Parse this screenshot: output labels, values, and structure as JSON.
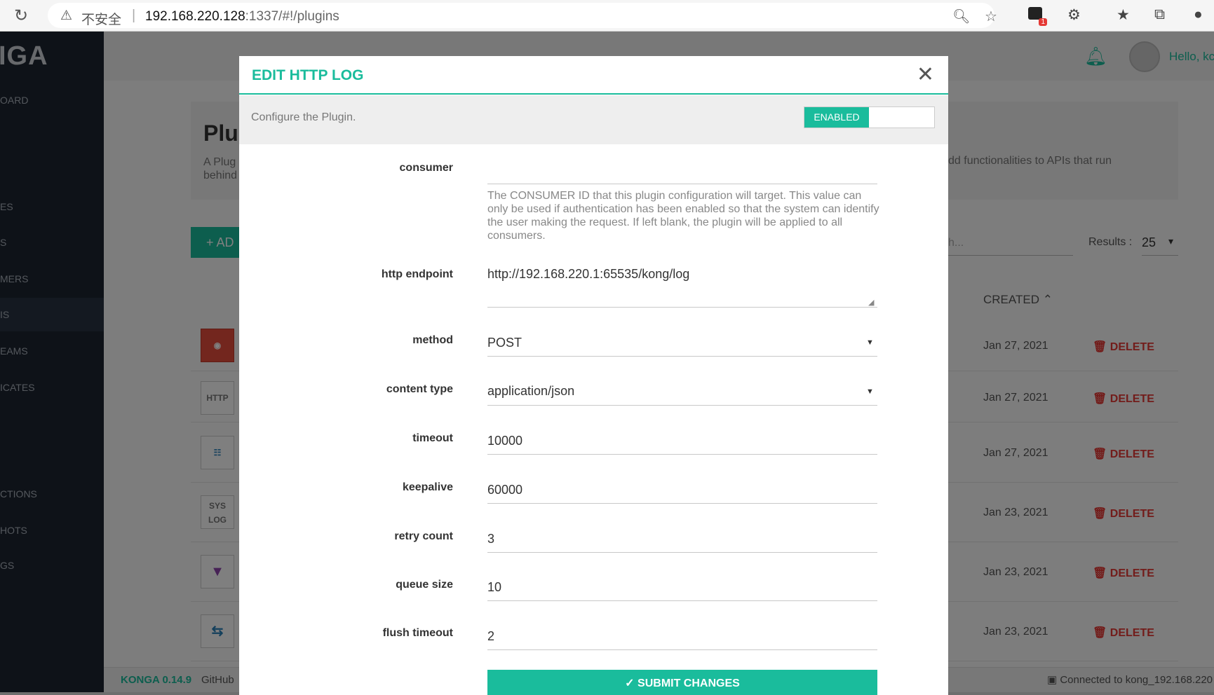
{
  "browser": {
    "insecure_label": "不安全",
    "url_host": "192.168.220.128",
    "url_rest": ":1337/#!/plugins",
    "extension_badge": "1"
  },
  "app": {
    "logo": "IGA",
    "nav": [
      "OARD",
      "ES",
      "S",
      "MERS",
      "IS",
      "EAMS",
      "ICATES",
      "CTIONS",
      "HOTS",
      "GS"
    ],
    "hello": "Hello, kc",
    "page_title": "Plu",
    "page_desc": "A Plug behind",
    "page_desc_right": "dd functionalities to APIs that run",
    "add_label": "+ AD",
    "search_placeholder": "h...",
    "results_label": "Results :",
    "results_value": "25",
    "created_header": "CREATED",
    "rows": [
      {
        "icon": "prometheus",
        "date": "Jan 27, 2021",
        "action": "DELETE"
      },
      {
        "icon": "HTTP",
        "date": "Jan 27, 2021",
        "action": "DELETE"
      },
      {
        "icon": "file-log",
        "date": "Jan 27, 2021",
        "action": "DELETE"
      },
      {
        "icon": "SYS LOG",
        "date": "Jan 23, 2021",
        "action": "DELETE"
      },
      {
        "icon": "filter",
        "date": "Jan 23, 2021",
        "action": "DELETE"
      },
      {
        "icon": "transform",
        "date": "Jan 23, 2021",
        "action": "DELETE"
      }
    ],
    "footer_version": "KONGA 0.14.9",
    "footer_github": "GitHub",
    "footer_connected": "Connected to kong_192.168.220"
  },
  "modal": {
    "title": "EDIT HTTP LOG",
    "subtitle": "Configure the Plugin.",
    "toggle_label": "ENABLED",
    "consumer_label": "consumer",
    "consumer_value": "",
    "consumer_help": "The CONSUMER ID that this plugin configuration will target. This value can only be used if authentication has been enabled so that the system can identify the user making the request. If left blank, the plugin will be applied to all consumers.",
    "http_endpoint_label": "http endpoint",
    "http_endpoint_value": "http://192.168.220.1:65535/kong/log",
    "method_label": "method",
    "method_value": "POST",
    "content_type_label": "content type",
    "content_type_value": "application/json",
    "timeout_label": "timeout",
    "timeout_value": "10000",
    "keepalive_label": "keepalive",
    "keepalive_value": "60000",
    "retry_count_label": "retry count",
    "retry_count_value": "3",
    "queue_size_label": "queue size",
    "queue_size_value": "10",
    "flush_timeout_label": "flush timeout",
    "flush_timeout_value": "2",
    "submit_label": "SUBMIT CHANGES"
  }
}
